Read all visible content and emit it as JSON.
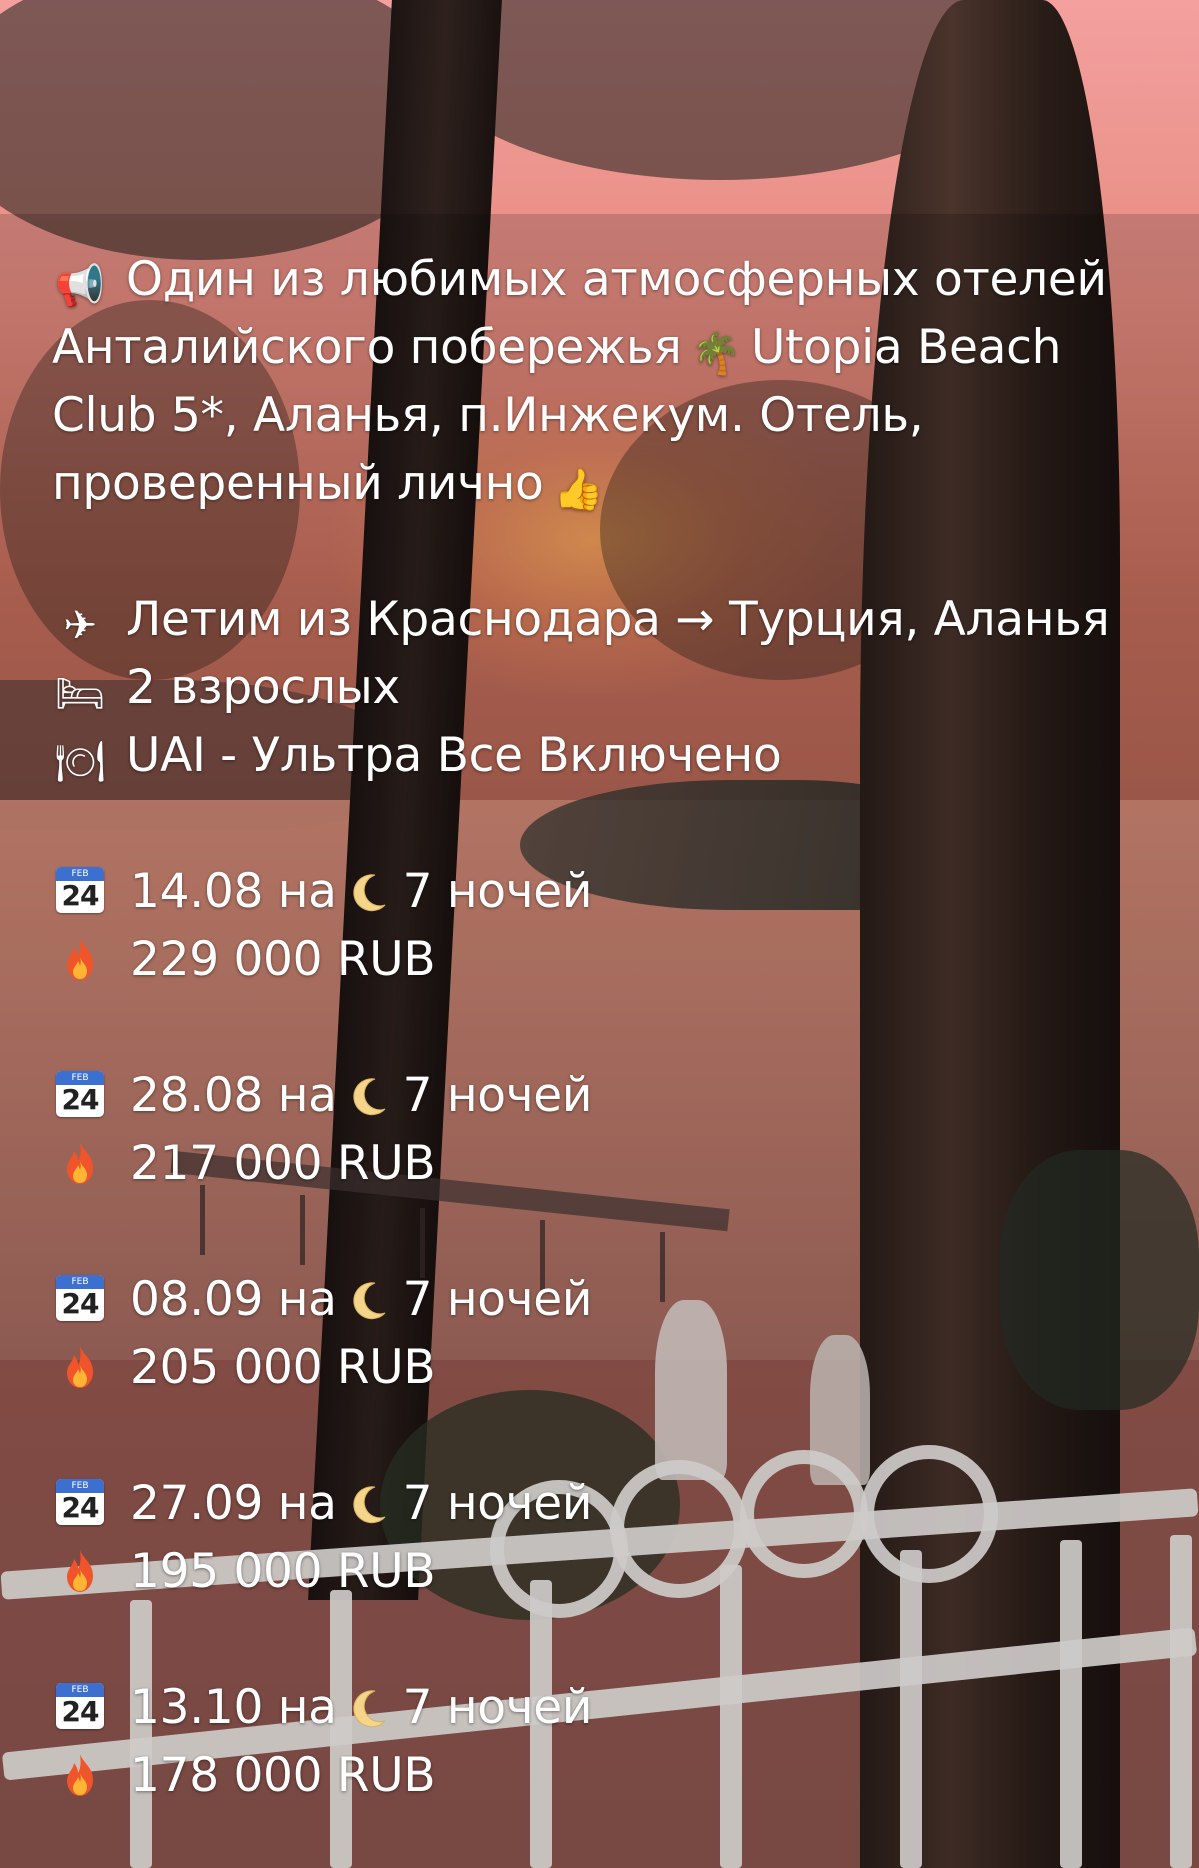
{
  "intro": {
    "icon": "megaphone-icon",
    "lines": [
      "Один из любимых атмосферных отелей",
      "Анталийского побережья",
      "Utopia Beach",
      "Club 5*, Аланья, п.Инжекум. Отель,",
      "проверенный лично"
    ],
    "palm_icon": "palm-tree-icon",
    "thumb_icon": "thumbs-up-icon"
  },
  "details": [
    {
      "icon": "airplane-icon",
      "text": "Летим из Краснодара → Турция, Аланья"
    },
    {
      "icon": "bed-icon",
      "text": "2 взрослых"
    },
    {
      "icon": "plate-cutlery-icon",
      "text": "UAI - Ультра Все Включено"
    }
  ],
  "calendar_icon": {
    "month": "FEB",
    "day": "24"
  },
  "offers": [
    {
      "date": "14.08 на",
      "nights": "7 ночей",
      "price": "229 000 RUB"
    },
    {
      "date": "28.08 на",
      "nights": "7 ночей",
      "price": "217 000 RUB"
    },
    {
      "date": "08.09 на",
      "nights": "7 ночей",
      "price": "205 000 RUB"
    },
    {
      "date": "27.09 на",
      "nights": "7 ночей",
      "price": "195 000 RUB"
    },
    {
      "date": "13.10 на",
      "nights": "7 ночей",
      "price": "178 000 RUB"
    }
  ]
}
